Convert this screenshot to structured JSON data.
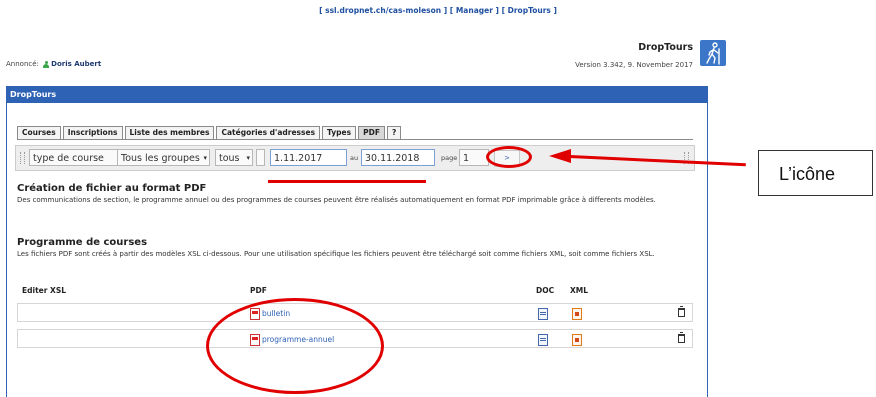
{
  "top_links": {
    "link1": "[ ssl.dropnet.ch/cas-moleson ]",
    "link2": "[ Manager ]",
    "link3": "[ DropTours ]"
  },
  "announce": {
    "label": "Annoncé:",
    "user": "Doris Aubert"
  },
  "brand": {
    "name": "DropTours",
    "version": "Version 3.342, 9. November 2017"
  },
  "panel": {
    "title": "DropTours"
  },
  "tabs": [
    "Courses",
    "Inscriptions",
    "Liste des membres",
    "Catégories d'adresses",
    "Types",
    "PDF",
    "?"
  ],
  "toolbar": {
    "type_course": "type de course",
    "groups": "Tous les groupes",
    "tous": "tous",
    "date_from": "1.11.2017",
    "au": "au",
    "date_to": "30.11.2018",
    "page_label": "page",
    "page_value": "1",
    "go": ">"
  },
  "pdf_section": {
    "title": "Création de fichier au format PDF",
    "desc": "Des communications de section, le programme annuel ou des programmes de courses peuvent être réalisés automatiquement en format PDF imprimable grâce à differents modèles."
  },
  "programme_section": {
    "title": "Programme de courses",
    "desc": "Les fichiers PDF sont créés à partir des modèles XSL ci-dessous. Pour une utilisation spécifique les fichiers peuvent être téléchargé soit comme fichiers XML, soit comme fichiers XSL."
  },
  "table": {
    "headers": {
      "editer": "Editer XSL",
      "pdf": "PDF",
      "doc": "DOC",
      "xml": "XML"
    },
    "rows": [
      {
        "pdf": "bulletin"
      },
      {
        "pdf": "programme-annuel"
      }
    ]
  },
  "callout": {
    "text": "L’icône"
  },
  "colors": {
    "accent_blue": "#2e62b4",
    "annotation_red": "#e00000"
  }
}
